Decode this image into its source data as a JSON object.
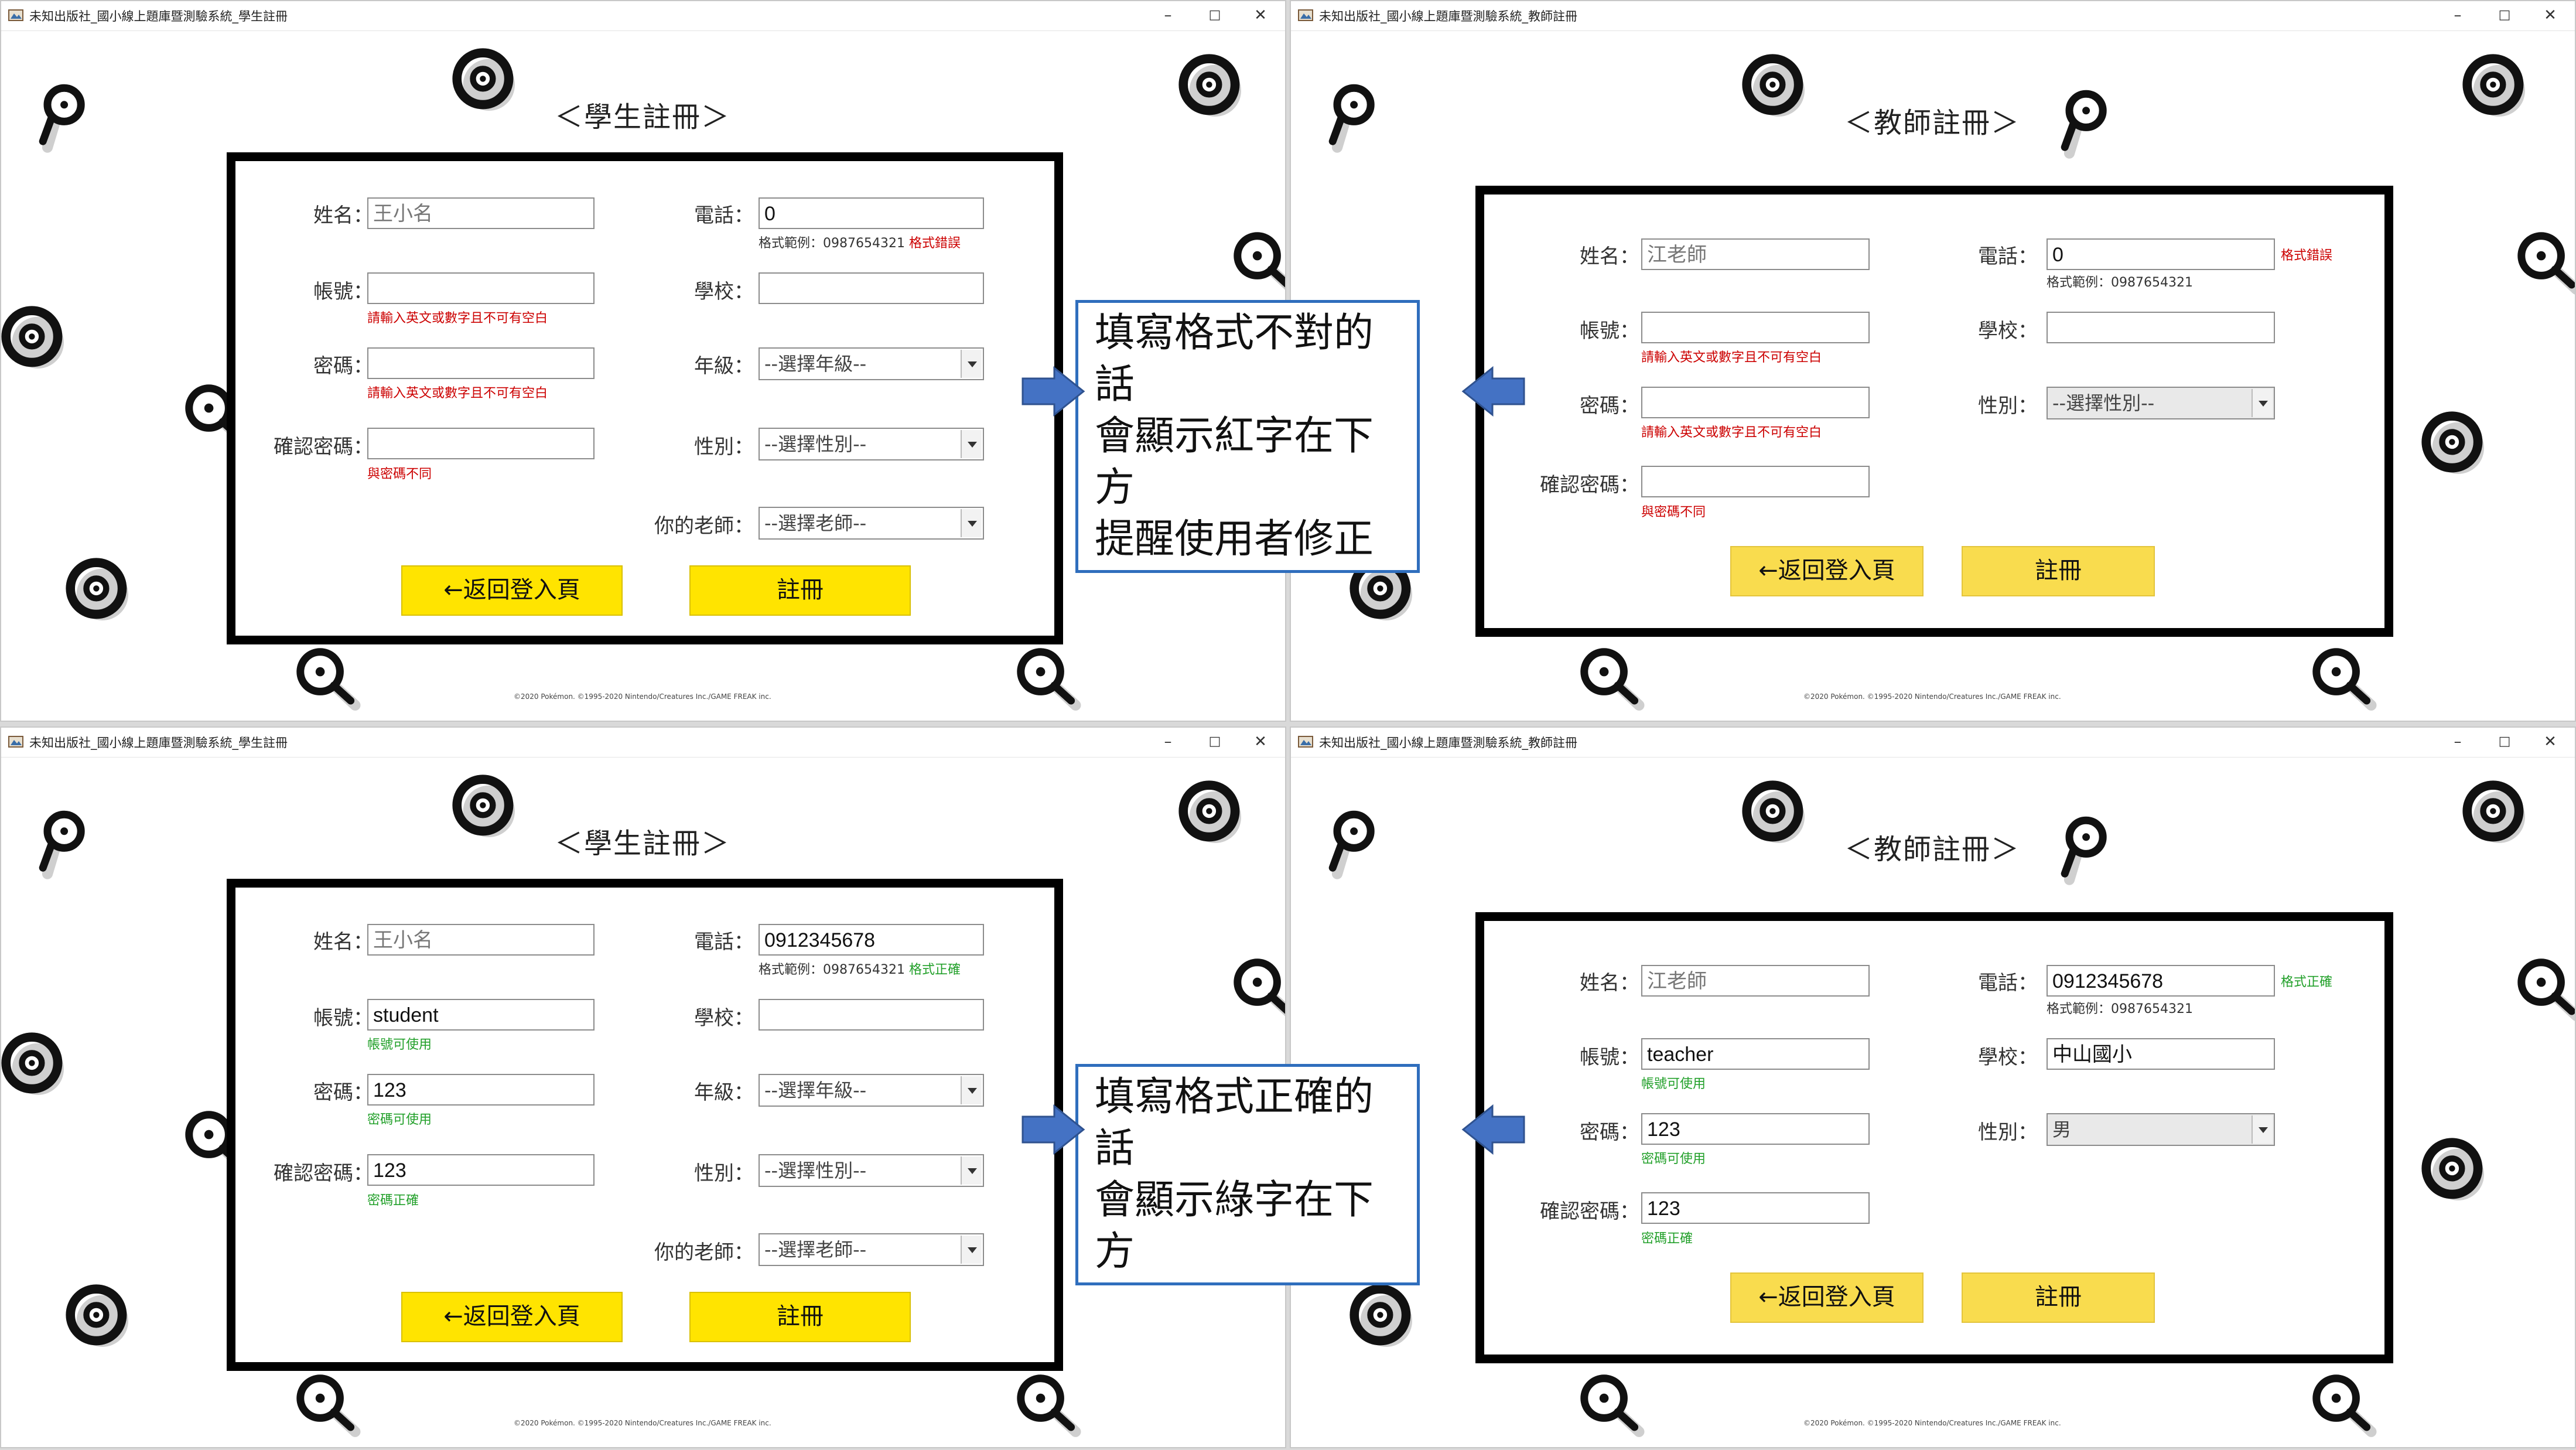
{
  "windows": {
    "student_error": {
      "title": "未知出版社_國小線上題庫暨測驗系統_學生註冊",
      "heading": "＜學生註冊＞",
      "labels": {
        "name": "姓名：",
        "account": "帳號：",
        "password": "密碼：",
        "confirm": "確認密碼：",
        "phone": "電話：",
        "school": "學校：",
        "grade": "年級：",
        "gender": "性別：",
        "teacher": "你的老師："
      },
      "values": {
        "name": "王小名",
        "account": "",
        "password": "",
        "confirm": "",
        "phone": "0",
        "school": ""
      },
      "selects": {
        "grade": "--選擇年級--",
        "gender": "--選擇性別--",
        "teacher": "--選擇老師--"
      },
      "messages": {
        "phone_hint": "格式範例：0987654321",
        "phone_status": "格式錯誤",
        "account": "請輸入英文或數字且不可有空白",
        "password": "請輸入英文或數字且不可有空白",
        "confirm": "與密碼不同"
      },
      "buttons": {
        "back": "←返回登入頁",
        "register": "註冊"
      },
      "copyright": "©2020 Pokémon. ©1995-2020 Nintendo/Creatures Inc./GAME FREAK inc."
    },
    "teacher_error": {
      "title": "未知出版社_國小線上題庫暨測驗系統_教師註冊",
      "heading": "＜教師註冊＞",
      "labels": {
        "name": "姓名：",
        "account": "帳號：",
        "password": "密碼：",
        "confirm": "確認密碼：",
        "phone": "電話：",
        "school": "學校：",
        "gender": "性別："
      },
      "values": {
        "name": "江老師",
        "account": "",
        "password": "",
        "confirm": "",
        "phone": "0",
        "school": ""
      },
      "selects": {
        "gender": "--選擇性別--"
      },
      "messages": {
        "phone_hint": "格式範例：0987654321",
        "phone_status": "格式錯誤",
        "account": "請輸入英文或數字且不可有空白",
        "password": "請輸入英文或數字且不可有空白",
        "confirm": "與密碼不同"
      },
      "buttons": {
        "back": "←返回登入頁",
        "register": "註冊"
      },
      "copyright": "©2020 Pokémon. ©1995-2020 Nintendo/Creatures Inc./GAME FREAK inc."
    },
    "student_ok": {
      "title": "未知出版社_國小線上題庫暨測驗系統_學生註冊",
      "heading": "＜學生註冊＞",
      "labels": {
        "name": "姓名：",
        "account": "帳號：",
        "password": "密碼：",
        "confirm": "確認密碼：",
        "phone": "電話：",
        "school": "學校：",
        "grade": "年級：",
        "gender": "性別：",
        "teacher": "你的老師："
      },
      "values": {
        "name": "王小名",
        "account": "student",
        "password": "123",
        "confirm": "123",
        "phone": "0912345678",
        "school": ""
      },
      "selects": {
        "grade": "--選擇年級--",
        "gender": "--選擇性別--",
        "teacher": "--選擇老師--"
      },
      "messages": {
        "phone_hint": "格式範例：0987654321",
        "phone_status": "格式正確",
        "account": "帳號可使用",
        "password": "密碼可使用",
        "confirm": "密碼正確"
      },
      "buttons": {
        "back": "←返回登入頁",
        "register": "註冊"
      },
      "copyright": "©2020 Pokémon. ©1995-2020 Nintendo/Creatures Inc./GAME FREAK inc."
    },
    "teacher_ok": {
      "title": "未知出版社_國小線上題庫暨測驗系統_教師註冊",
      "heading": "＜教師註冊＞",
      "labels": {
        "name": "姓名：",
        "account": "帳號：",
        "password": "密碼：",
        "confirm": "確認密碼：",
        "phone": "電話：",
        "school": "學校：",
        "gender": "性別："
      },
      "values": {
        "name": "江老師",
        "account": "teacher",
        "password": "123",
        "confirm": "123",
        "phone": "0912345678",
        "school": "中山國小"
      },
      "selects": {
        "gender": "男"
      },
      "messages": {
        "phone_hint": "格式範例：0987654321",
        "phone_status": "格式正確",
        "account": "帳號可使用",
        "password": "密碼可使用",
        "confirm": "密碼正確"
      },
      "buttons": {
        "back": "←返回登入頁",
        "register": "註冊"
      },
      "copyright": "©2020 Pokémon. ©1995-2020 Nintendo/Creatures Inc./GAME FREAK inc."
    }
  },
  "callouts": {
    "error": [
      "填寫格式不對的話",
      "會顯示紅字在下方",
      "提醒使用者修正"
    ],
    "ok": [
      "填寫格式正確的話",
      "會顯示綠字在下方"
    ]
  },
  "window_controls": {
    "minimize": "–",
    "maximize": "□",
    "close": "✕"
  },
  "colors": {
    "error_text": "#cc0000",
    "ok_text": "#22a02a",
    "button": "#ffe400",
    "callout_border": "#2f6ebd",
    "arrow": "#4472c4"
  }
}
